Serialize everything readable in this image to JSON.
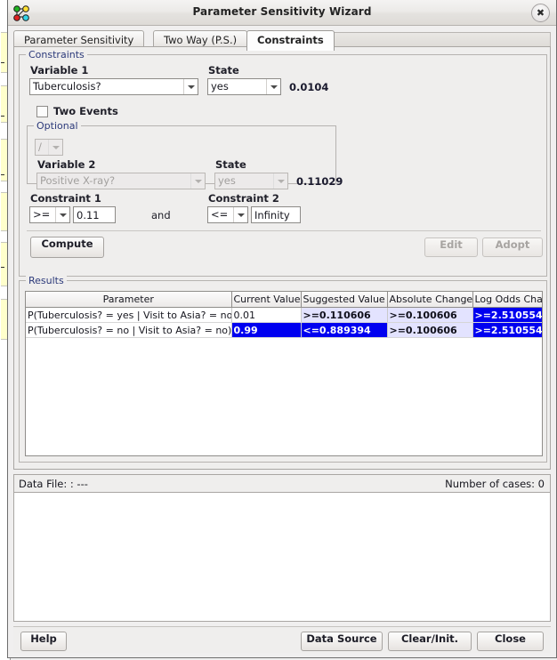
{
  "window": {
    "title": "Parameter Sensitivity Wizard",
    "icon": "network-graph-icon",
    "close_label": "✖"
  },
  "tabs": [
    {
      "label": "Parameter Sensitivity",
      "active": false
    },
    {
      "label": "Two Way (P.S.)",
      "active": false
    },
    {
      "label": "Constraints",
      "active": true
    }
  ],
  "constraints_group": {
    "legend": "Constraints",
    "variable1_label": "Variable 1",
    "variable1_value": "Tuberculosis?",
    "state1_label": "State",
    "state1_value": "yes",
    "probability1": "0.0104",
    "two_events_label": "Two Events",
    "two_events_checked": false,
    "optional": {
      "legend": "Optional",
      "operator_value": "/",
      "variable2_label": "Variable 2",
      "variable2_value": "Positive X-ray?",
      "state2_label": "State",
      "state2_value": "yes",
      "probability2": "0.11029"
    },
    "constraint1_label": "Constraint 1",
    "constraint1_operator": ">=",
    "constraint1_value": "0.11",
    "conjunction": "and",
    "constraint2_label": "Constraint 2",
    "constraint2_operator": "<=",
    "constraint2_value": "Infinity",
    "compute_label": "Compute",
    "edit_label": "Edit",
    "adopt_label": "Adopt"
  },
  "results": {
    "legend": "Results",
    "columns": [
      "Parameter",
      "Current Value",
      "Suggested Value",
      "Absolute Change",
      "Log Odds Change"
    ],
    "rows": [
      {
        "parameter": "P(Tuberculosis? = yes | Visit to Asia? = no)",
        "current_value": "0.01",
        "suggested_value": ">=0.110606",
        "absolute_change": ">=0.100606",
        "log_odds_change": ">=2.510554",
        "styles": [
          "cell-param",
          "cell-plain",
          "cell-light",
          "cell-light",
          "cell-sel"
        ]
      },
      {
        "parameter": "P(Tuberculosis? = no | Visit to Asia? = no)",
        "current_value": "0.99",
        "suggested_value": "<=0.889394",
        "absolute_change": ">=0.100606",
        "log_odds_change": ">=2.510554",
        "styles": [
          "cell-param",
          "cell-sel",
          "cell-sel",
          "cell-light",
          "cell-sel"
        ]
      }
    ]
  },
  "status": {
    "data_file": "Data File: : ---",
    "number_of_cases": "Number of cases: 0"
  },
  "footer": {
    "help_label": "Help",
    "data_source_label": "Data Source",
    "clear_init_label": "Clear/Init.",
    "close_label": "Close"
  },
  "colors": {
    "selection_blue": "#0000f0",
    "highlight_lavender": "#e3e3ff",
    "legend_text": "#2c3a7a",
    "window_face": "#efeeed"
  }
}
